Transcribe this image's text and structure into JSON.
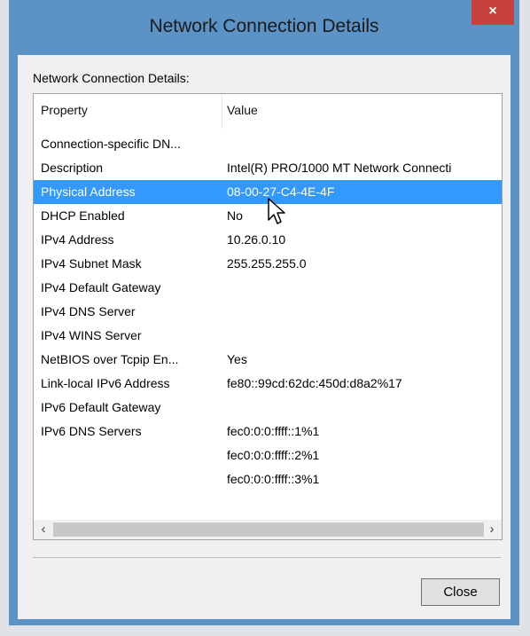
{
  "window": {
    "title": "Network Connection Details",
    "close_glyph": "×",
    "group_label": "Network Connection Details:"
  },
  "listview": {
    "columns": [
      "Property",
      "Value"
    ],
    "rows": [
      {
        "property": "Connection-specific DN...",
        "value": ""
      },
      {
        "property": "Description",
        "value": "Intel(R) PRO/1000 MT Network Connecti"
      },
      {
        "property": "Physical Address",
        "value": "08-00-27-C4-4E-4F",
        "selected": true
      },
      {
        "property": "DHCP Enabled",
        "value": "No"
      },
      {
        "property": "IPv4 Address",
        "value": "10.26.0.10"
      },
      {
        "property": "IPv4 Subnet Mask",
        "value": "255.255.255.0"
      },
      {
        "property": "IPv4 Default Gateway",
        "value": ""
      },
      {
        "property": "IPv4 DNS Server",
        "value": ""
      },
      {
        "property": "IPv4 WINS Server",
        "value": ""
      },
      {
        "property": "NetBIOS over Tcpip En...",
        "value": "Yes"
      },
      {
        "property": "Link-local IPv6 Address",
        "value": "fe80::99cd:62dc:450d:d8a2%17"
      },
      {
        "property": "IPv6 Default Gateway",
        "value": ""
      },
      {
        "property": "IPv6 DNS Servers",
        "value": "fec0:0:0:ffff::1%1"
      },
      {
        "property": "",
        "value": "fec0:0:0:ffff::2%1"
      },
      {
        "property": "",
        "value": "fec0:0:0:ffff::3%1"
      }
    ],
    "scroll_left_glyph": "‹",
    "scroll_right_glyph": "›"
  },
  "buttons": {
    "close_label": "Close"
  },
  "colors": {
    "titlebar": "#5b93c7",
    "selection": "#3399ff",
    "close_button": "#c7423d"
  }
}
